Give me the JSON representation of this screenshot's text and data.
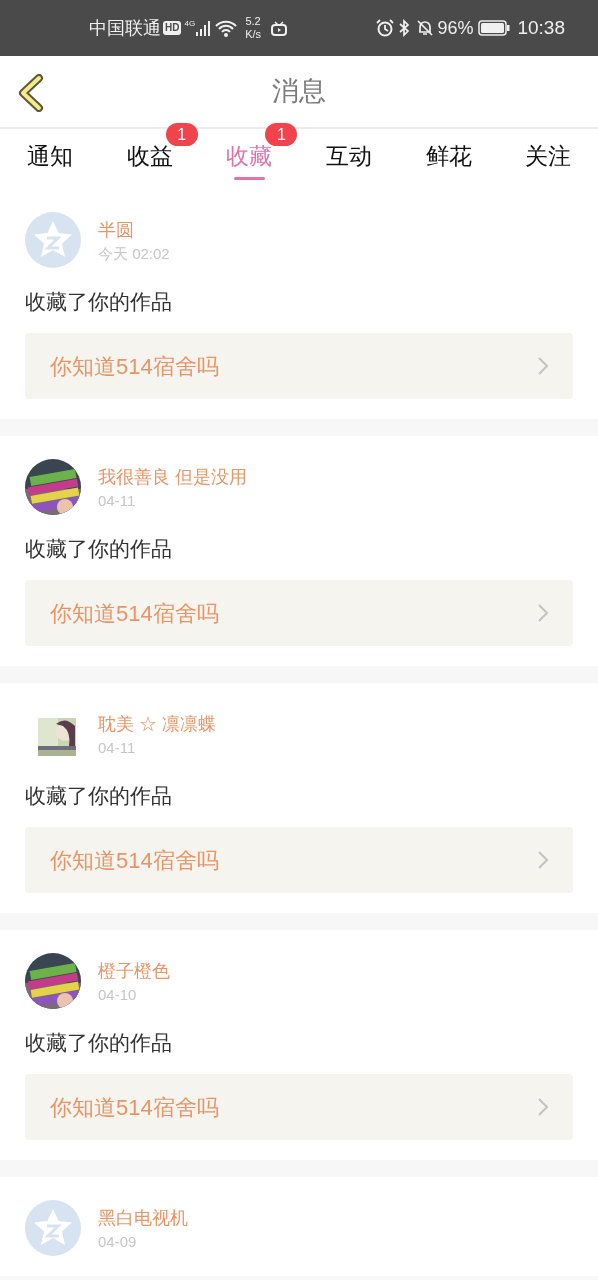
{
  "status_bar": {
    "carrier": "中国联通",
    "hd": "HD",
    "network": "4G",
    "speed": "5.2",
    "speed_unit": "K/s",
    "battery": "96%",
    "time": "10:38"
  },
  "header": {
    "title": "消息"
  },
  "tabs": [
    {
      "label": "通知",
      "selected": false
    },
    {
      "label": "收益",
      "selected": false,
      "badge": "1"
    },
    {
      "label": "收藏",
      "selected": true,
      "badge": "1"
    },
    {
      "label": "互动",
      "selected": false
    },
    {
      "label": "鲜花",
      "selected": false
    },
    {
      "label": "关注",
      "selected": false
    }
  ],
  "messages": [
    {
      "avatar": {
        "kind": "default"
      },
      "name": "半圆",
      "time": "今天 02:02",
      "text": "收藏了你的作品",
      "work": "你知道514宿舍吗"
    },
    {
      "avatar": {
        "kind": "round-photo"
      },
      "name": "我很善良 但是没用",
      "time": "04-11",
      "text": "收藏了你的作品",
      "work": "你知道514宿舍吗"
    },
    {
      "avatar": {
        "kind": "square-photo"
      },
      "name": "耽美 ☆ 凛凛蝶",
      "time": "04-11",
      "text": "收藏了你的作品",
      "work": "你知道514宿舍吗"
    },
    {
      "avatar": {
        "kind": "round-photo"
      },
      "name": "橙子橙色",
      "time": "04-10",
      "text": "收藏了你的作品",
      "work": "你知道514宿舍吗"
    },
    {
      "avatar": {
        "kind": "default"
      },
      "name": "黑白电视机",
      "time": "04-09"
    }
  ]
}
